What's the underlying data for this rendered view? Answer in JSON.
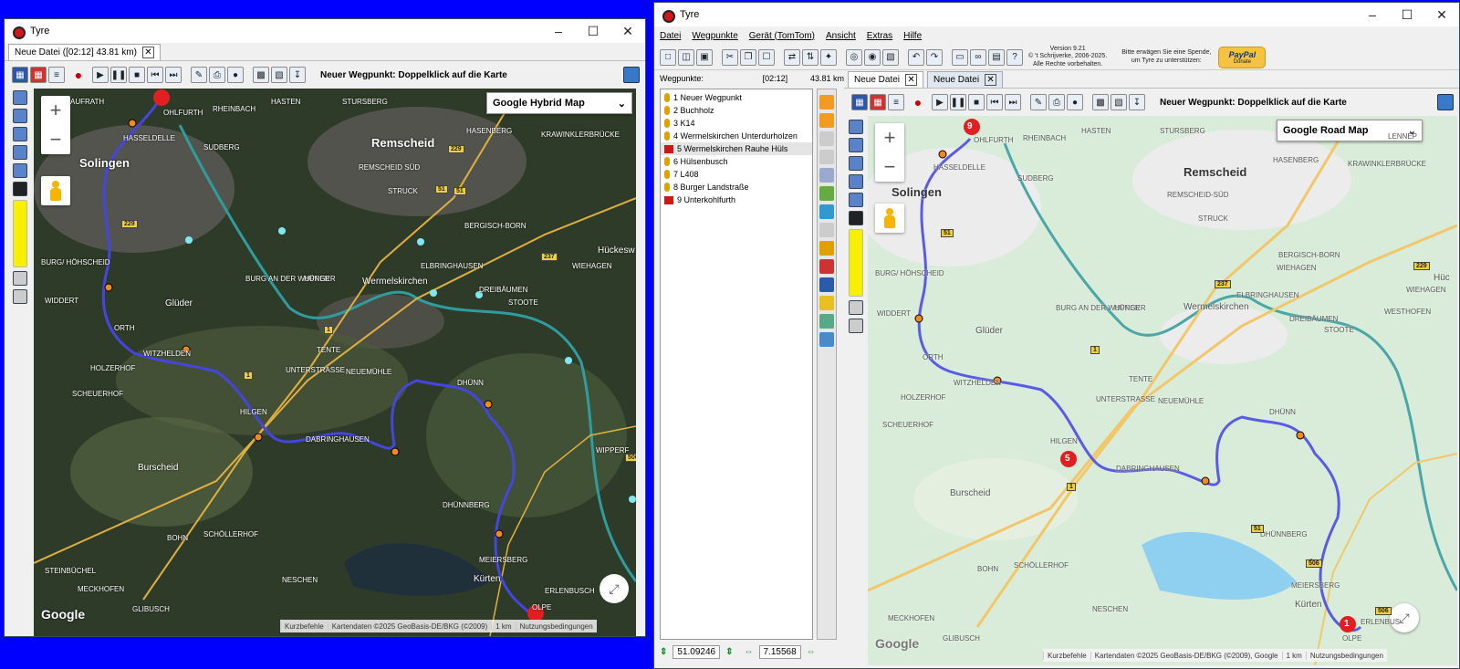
{
  "left_window": {
    "title": "Tyre",
    "tab_label": "Neue Datei ([02:12] 43.81 km)",
    "hint": "Neuer Wegpunkt: Doppelklick auf die Karte",
    "map_type": "Google Hybrid Map",
    "google_logo": "Google",
    "footer": {
      "shortcuts": "Kurzbefehle",
      "data": "Kartendaten ©2025 GeoBasis-DE/BKG (©2009)",
      "scale": "1 km",
      "terms": "Nutzungsbedingungen"
    },
    "places": {
      "remscheid": "Remscheid",
      "solingen": "Solingen",
      "wermelskirchen": "Wermelskirchen",
      "burscheid": "Burscheid",
      "glueder": "Glüder",
      "kuerten": "Kürten",
      "hueckeswagen": "Hückesw",
      "aufrath": "AUFRATH",
      "ohlfurth": "OHLFURTH",
      "hasselsdelle": "HASSELDELLE",
      "rheinbach": "RHEINBACH",
      "hasten": "HASTEN",
      "stursberg": "STURSBERG",
      "hasenberg": "HASENBERG",
      "krawinkel": "KRAWINKLERBRÜCKE",
      "suedberg": "SUDBERG",
      "remscheidsued": "REMSCHEID SÜD",
      "struck": "STRUCK",
      "bergischborn": "BERGISCH-BORN",
      "elbringhausen": "ELBRINGHAUSEN",
      "wiehagen": "WIEHAGEN",
      "dreibaeumen": "DREIBÄUMEN",
      "stoote": "STOOTE",
      "burgwupper": "BURG AN DER WUPPER",
      "huenger": "HÜNGER",
      "burg": "BURG/ HÖHSCHEID",
      "widdert": "WIDDERT",
      "orth": "ORTH",
      "witzhelden": "WITZHELDEN",
      "holzerhof": "HOLZERHOF",
      "tente": "TENTE",
      "unterstrasse": "UNTERSTRASSE",
      "neuemuehle": "NEUEMÜHLE",
      "scheuerhof": "SCHEUERHOF",
      "hilgen": "HILGEN",
      "dabringhausen": "DABRINGHAUSEN",
      "dhuenn": "DHÜNN",
      "wipperfeld": "WIPPERF",
      "dhuennberg": "DHÜNNBERG",
      "schoellerhof": "SCHÖLLERHOF",
      "bohn": "BOHN",
      "steinbuechel": "STEINBÜCHEL",
      "meiersberg": "MEIERSBERG",
      "meckhofen": "MECKHOFEN",
      "neschen": "NESCHEN",
      "erlenbusch": "ERLENBUSCH",
      "olpe": "OLPE",
      "gliebusch": "GLIBUSCH"
    }
  },
  "right_window": {
    "title": "Tyre",
    "menu": [
      "Datei",
      "Wegpunkte",
      "Gerät (TomTom)",
      "Ansicht",
      "Extras",
      "Hilfe"
    ],
    "version": {
      "line1": "Version 9.21",
      "line2": "© 't Schrijverke, 2006-2025.",
      "line3": "Alle Rechte vorbehalten."
    },
    "donate_text": {
      "line1": "Bitte erwägen Sie eine Spende,",
      "line2": "um Tyre zu unterstützen:"
    },
    "paypal": {
      "brand": "PayPal",
      "label": "Donate"
    },
    "waypoints_label": "Wegpunkte:",
    "duration": "[02:12]",
    "distance": "43.81 km",
    "waypoints": [
      {
        "label": "1 Neuer Wegpunkt",
        "kind": "pin"
      },
      {
        "label": "2 Buchholz",
        "kind": "pin"
      },
      {
        "label": "3 K14",
        "kind": "pin"
      },
      {
        "label": "4 Wermelskirchen Unterdurholzen",
        "kind": "pin"
      },
      {
        "label": "5 Wermelskirchen Rauhe Hüls",
        "kind": "flag"
      },
      {
        "label": "6 Hülsenbusch",
        "kind": "pin"
      },
      {
        "label": "7 L408",
        "kind": "pin"
      },
      {
        "label": "8 Burger Landstraße",
        "kind": "pin"
      },
      {
        "label": "9 Unterkohlfurth",
        "kind": "flag"
      }
    ],
    "coord_lat": "51.09246",
    "coord_lon": "7.15568",
    "tabs": [
      "Neue Datei",
      "Neue Datei"
    ],
    "hint": "Neuer Wegpunkt: Doppelklick auf die Karte",
    "map_type": "Google Road Map",
    "google_logo": "Google",
    "footer": {
      "shortcuts": "Kurzbefehle",
      "data": "Kartendaten ©2025 GeoBasis-DE/BKG (©2009), Google",
      "scale": "1 km",
      "terms": "Nutzungsbedingungen"
    },
    "places": {
      "remscheid": "Remscheid",
      "solingen": "Solingen",
      "wermelskirchen": "Wermelskirchen",
      "burscheid": "Burscheid",
      "glueder": "Glüder",
      "kuerten": "Kürten",
      "hueckeswagen": "Hüc",
      "ohlfurth": "OHLFURTH",
      "hasselsdelle": "HASSELDELLE",
      "rheinbach": "RHEINBACH",
      "hasten": "HASTEN",
      "stursberg": "STURSBERG",
      "hasenberg": "HASENBERG",
      "krawinkel": "KRAWINKLERBRÜCKE",
      "suedberg": "SUDBERG",
      "remscheidsued": "REMSCHEID-SÜD",
      "struck": "STRUCK",
      "bergischborn": "BERGISCH-BORN",
      "elbringhausen": "ELBRINGHAUSEN",
      "wiehagen": "WIEHAGEN",
      "wiehagen2": "WIEHAGEN",
      "westhofen": "WESTHOFEN",
      "dreibaeumen": "DREIBÄUMEN",
      "stoote": "STOOTE",
      "burgwupper": "BURG AN DER WUPPER",
      "huenger": "HÜNGER",
      "burg": "BURG/ HÖHSCHEID",
      "widdert": "WIDDERT",
      "orth": "ORTH",
      "witzhelden": "WITZHELDEN",
      "holzerhof": "HOLZERHOF",
      "tente": "TENTE",
      "unterstrasse": "UNTERSTRASSE",
      "neuemuehle": "NEUEMÜHLE",
      "scheuerhof": "SCHEUERHOF",
      "hilgen": "HILGEN",
      "dabringhausen": "DABRINGHAUSEN",
      "dhuenn": "DHÜNN",
      "dhuennberg": "DHÜNNBERG",
      "schoellerhof": "SCHÖLLERHOF",
      "bohn": "BOHN",
      "meiersberg": "MEIERSBERG",
      "meckhofen": "MECKHOFEN",
      "neschen": "NESCHEN",
      "erlenbusch": "ERLENBUS",
      "olpe": "OLPE",
      "lennep": "LENNEP",
      "gliebusch": "GLIBUSCH"
    },
    "markers": {
      "start": "1",
      "mid": "5",
      "end": "9"
    }
  },
  "road_numbers": [
    "229",
    "51",
    "237",
    "1",
    "506",
    "229",
    "51",
    "1",
    "51",
    "229",
    "237",
    "1",
    "1",
    "51",
    "506",
    "506"
  ]
}
